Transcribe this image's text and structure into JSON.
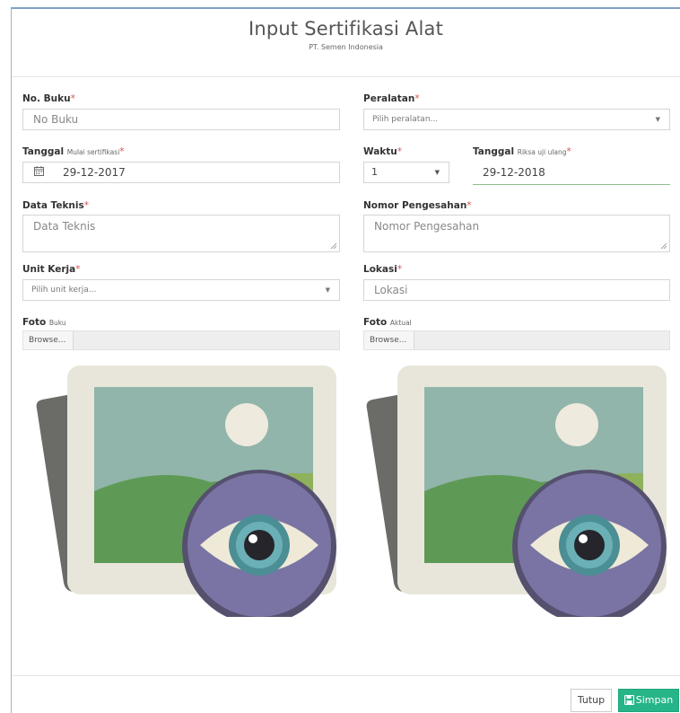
{
  "header": {
    "title": "Input Sertifikasi Alat",
    "subtitle": "PT. Semen Indonesia"
  },
  "form": {
    "no_buku": {
      "label": "No. Buku",
      "required": "*",
      "placeholder": "No Buku"
    },
    "peralatan": {
      "label": "Peralatan",
      "required": "*",
      "placeholder": "Pilih peralatan..."
    },
    "tanggal_mulai": {
      "label": "Tanggal",
      "small": "Mulai sertifikasi",
      "required": "*",
      "value": "29-12-2017"
    },
    "waktu": {
      "label": "Waktu",
      "required": "*",
      "value": "1"
    },
    "tanggal_riksa": {
      "label": "Tanggal",
      "small": "Riksa uji ulang",
      "required": "*",
      "value": "29-12-2018"
    },
    "data_teknis": {
      "label": "Data Teknis",
      "required": "*",
      "placeholder": "Data Teknis"
    },
    "nomor_pengesahan": {
      "label": "Nomor Pengesahan",
      "required": "*",
      "placeholder": "Nomor Pengesahan"
    },
    "unit_kerja": {
      "label": "Unit Kerja",
      "required": "*",
      "placeholder": "Pilih unit kerja..."
    },
    "lokasi": {
      "label": "Lokasi",
      "required": "*",
      "placeholder": "Lokasi"
    },
    "foto_buku": {
      "label": "Foto",
      "small": "Buku",
      "browse": "Browse..."
    },
    "foto_aktual": {
      "label": "Foto",
      "small": "Aktual",
      "browse": "Browse..."
    }
  },
  "icons": {
    "calendar": "calendar-icon",
    "caret": "caret-down-icon",
    "save": "floppy-disk-icon",
    "preview": "image-preview-eye-icon"
  },
  "footer": {
    "tutup_label": "Tutup",
    "simpan_label": "Simpan"
  },
  "colors": {
    "required": "#d9534f",
    "primary_button": "#26b589",
    "header_border": "#7fa2c4"
  }
}
